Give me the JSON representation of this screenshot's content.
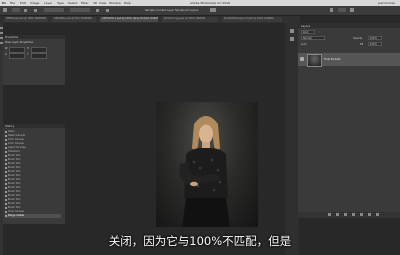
{
  "app": {
    "menu_items": [
      "Ps",
      "File",
      "Edit",
      "Image",
      "Layer",
      "Type",
      "Select",
      "Filter",
      "3D",
      "View",
      "Window",
      "Help"
    ],
    "window_title": "Adobe Photoshop CC 2018",
    "user": "Joel Grimes"
  },
  "options": {
    "field1": "Sample: Current Layer",
    "field2": "Sample All Layers"
  },
  "tabs": [
    {
      "label": "TEMSeries.psd @ 100% (RGB/8#)",
      "active": false
    },
    {
      "label": "ORIGINAL.psd @ 50% (RGB/8#)",
      "active": false
    },
    {
      "label": "UNTITLED-1.psd @ 100% (Gray Portrait, RGB/8)",
      "active": true
    },
    {
      "label": "Portrait Copy.psd @ 100% (RGB/8)",
      "active": false
    },
    {
      "label": "Portrait Background.psd @ 100% (RGB/8)",
      "active": false
    }
  ],
  "properties_panel": {
    "title": "Properties",
    "subtitle": "Pixel Layer Properties",
    "w_label": "W",
    "h_label": "H",
    "x_label": "X",
    "y_label": "Y"
  },
  "history_panel": {
    "title": "History",
    "items": [
      "Open",
      "Select Canvas",
      "Color Canvas",
      "Color Canvas",
      "Layer Via Copy",
      "Transform",
      "Brush Tool",
      "Brush Tool",
      "Brush Tool",
      "Brush Tool",
      "Brush Tool",
      "Brush Tool",
      "Brush Tool",
      "Brush Tool",
      "Brush Tool",
      "Brush Tool",
      "Brush Tool",
      "Brush Tool",
      "Brush Tool",
      "Brush Tool",
      "Color Canvas",
      "Merge Visible"
    ],
    "selected_index": 21
  },
  "layers_panel": {
    "title": "Layers",
    "kind_label": "Kind",
    "blend_mode": "Normal",
    "opacity_label": "Opacity",
    "opacity": "100%",
    "fill_label": "Fill",
    "fill": "100%",
    "lock_label": "Lock",
    "layers": [
      {
        "name": "Final Portrait"
      }
    ]
  },
  "subtitle": "关闭，因为它与100%不匹配，但是"
}
